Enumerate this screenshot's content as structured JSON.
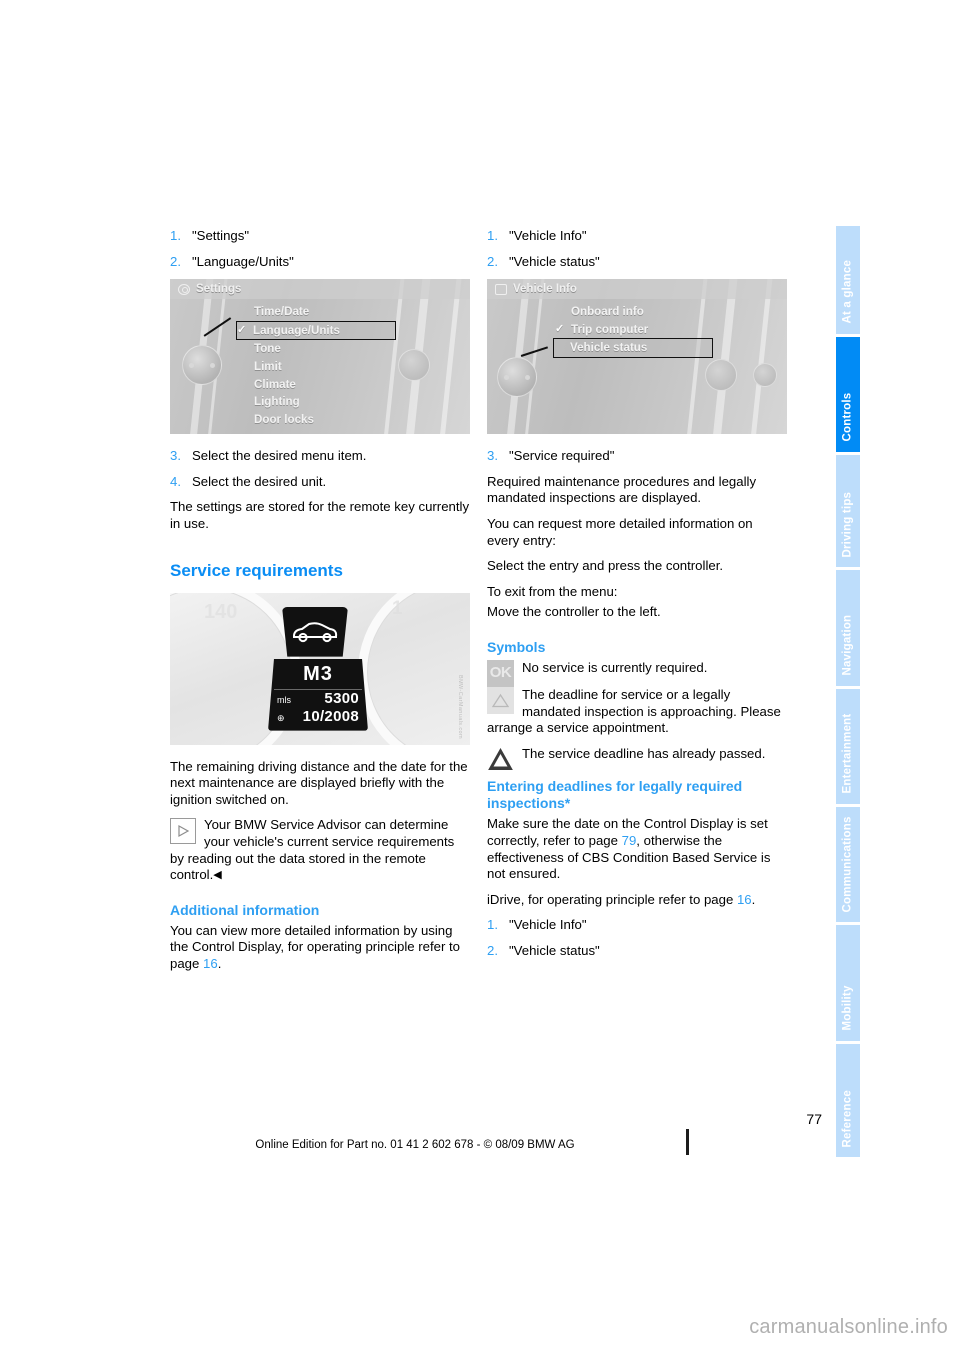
{
  "document": {
    "page_number": "77",
    "footer_note": "Online Edition for Part no. 01 41 2 602 678 - © 08/09 BMW AG",
    "watermark": "carmanualsonline.info"
  },
  "sidebar": {
    "active": "Controls",
    "tabs": [
      {
        "label": "At a glance",
        "active": false
      },
      {
        "label": "Controls",
        "active": true
      },
      {
        "label": "Driving tips",
        "active": false
      },
      {
        "label": "Navigation",
        "active": false
      },
      {
        "label": "Entertainment",
        "active": false
      },
      {
        "label": "Communications",
        "active": false
      },
      {
        "label": "Mobility",
        "active": false
      },
      {
        "label": "Reference",
        "active": false
      }
    ],
    "colors": {
      "active_bg": "#018bf5",
      "inactive_bg": "#bdddfb",
      "label": "#ffffff"
    }
  },
  "left_column": {
    "steps_top": [
      {
        "num": "1.",
        "text": "\"Settings\""
      },
      {
        "num": "2.",
        "text": "\"Language/Units\""
      }
    ],
    "figure_settings": {
      "header": "Settings",
      "header_icon": "gear-icon",
      "items": [
        {
          "label": "Time/Date",
          "checked": false,
          "selected": false
        },
        {
          "label": "Language/Units",
          "checked": true,
          "selected": true
        },
        {
          "label": "Tone",
          "checked": false,
          "selected": false
        },
        {
          "label": "Limit",
          "checked": false,
          "selected": false
        },
        {
          "label": "Climate",
          "checked": false,
          "selected": false
        },
        {
          "label": "Lighting",
          "checked": false,
          "selected": false
        },
        {
          "label": "Door locks",
          "checked": false,
          "selected": false
        }
      ]
    },
    "steps_bottom": [
      {
        "num": "3.",
        "text": "Select the desired menu item."
      },
      {
        "num": "4.",
        "text": "Select the desired unit."
      }
    ],
    "paragraph_stored": "The settings are stored for the remote key currently in use.",
    "service_heading": "Service requirements",
    "figure_cluster": {
      "model": "M3",
      "unit": "mls",
      "distance": "5300",
      "date": "10/2008",
      "dial_left_label": "140",
      "dial_right_label": "1",
      "credit": "BMW-CarManuals.com"
    },
    "paragraph_cluster": "The remaining driving distance and the date for the next maintenance are displayed briefly with the ignition switched on.",
    "note": {
      "icon": "play-triangle-icon",
      "text": "Your BMW Service Advisor can determine your vehicle's current service requirements by reading out the data stored in the remote control.",
      "endmark": "◀"
    },
    "additional_heading": "Additional information",
    "additional_text_a": "You can view more detailed information by using the Control Display, for operating principle refer to page ",
    "additional_pageref": "16",
    "additional_text_b": "."
  },
  "right_column": {
    "steps_top": [
      {
        "num": "1.",
        "text": "\"Vehicle Info\""
      },
      {
        "num": "2.",
        "text": "\"Vehicle status\""
      }
    ],
    "figure_vehicle_info": {
      "header": "Vehicle Info",
      "header_icon": "vehicle-info-icon",
      "items": [
        {
          "label": "Onboard info",
          "checked": false,
          "selected": false
        },
        {
          "label": "Trip computer",
          "checked": true,
          "selected": false
        },
        {
          "label": "Vehicle status",
          "checked": false,
          "selected": true
        }
      ]
    },
    "step_three": {
      "num": "3.",
      "text": "\"Service required\""
    },
    "paragraphs": [
      "Required maintenance procedures and legally mandated inspections are displayed.",
      "You can request more detailed information on every entry:",
      "Select the entry and press the controller."
    ],
    "exit_line_1": "To exit from the menu:",
    "exit_line_2": "Move the controller to the left.",
    "symbols_heading": "Symbols",
    "symbols": [
      {
        "icon": "ok-symbol-icon",
        "glyph": "OK",
        "text": "No service is currently required."
      },
      {
        "icon": "warning-triangle-light-icon",
        "glyph": "△",
        "text": "The deadline for service or a legally mandated inspection is approaching. Please arrange a service appointment."
      },
      {
        "icon": "warning-triangle-dark-icon",
        "glyph": "△",
        "text": "The service deadline has already passed."
      }
    ],
    "entering_heading": "Entering deadlines for legally required inspections*",
    "entering_text_a": "Make sure the date on the Control Display is set correctly, refer to page ",
    "entering_pageref_1": "79",
    "entering_text_b": ", otherwise the effectiveness of CBS Condition Based Service is not ensured.",
    "idrive_text_a": "iDrive, for operating principle refer to page ",
    "idrive_pageref": "16",
    "idrive_text_b": ".",
    "steps_bottom": [
      {
        "num": "1.",
        "text": "\"Vehicle Info\""
      },
      {
        "num": "2.",
        "text": "\"Vehicle status\""
      }
    ]
  }
}
